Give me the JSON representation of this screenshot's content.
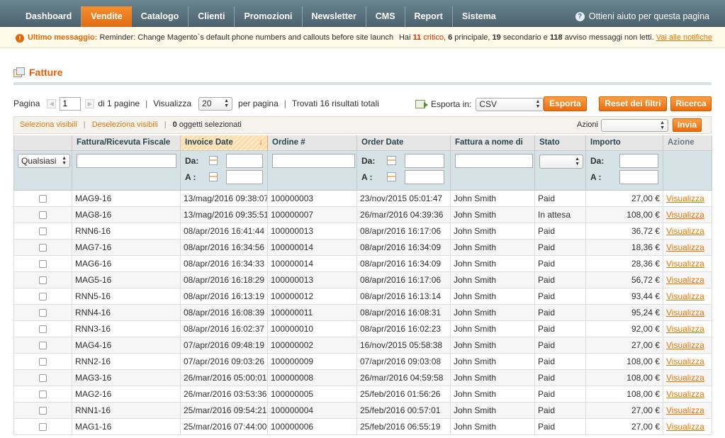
{
  "nav": {
    "items": [
      "Dashboard",
      "Vendite",
      "Catalogo",
      "Clienti",
      "Promozioni",
      "Newsletter",
      "CMS",
      "Report",
      "Sistema"
    ],
    "active_index": 1,
    "help_label": "Ottieni aiuto per questa pagina"
  },
  "notice": {
    "label": "Ultimo messaggio:",
    "text": "Reminder: Change Magento`s default phone numbers and callouts before site launch",
    "pre": "Hai",
    "critical_count": "11",
    "critical_label": "critico,",
    "major_count": "6",
    "major_label": "principale,",
    "minor_count": "19",
    "minor_label": "secondario e",
    "notice_count": "118",
    "notice_label": "avviso messaggi non letti.",
    "link": "Vai alle notifiche"
  },
  "page": {
    "title": "Fatture"
  },
  "pager": {
    "page_label": "Pagina",
    "page_value": "1",
    "of_pages": "di 1 pagine",
    "show_label": "Visualizza",
    "per_page_value": "20",
    "per_page_label": "per pagina",
    "found": "Trovati 16 risultati totali"
  },
  "export": {
    "label": "Esporta in:",
    "format": "CSV",
    "export_button": "Esporta",
    "reset_button": "Reset dei filtri",
    "search_button": "Ricerca"
  },
  "massaction": {
    "select_visible": "Seleziona visibili",
    "deselect_visible": "Deseleziona visibili",
    "selected_count": "0",
    "selected_label": "oggetti selezionati",
    "actions_label": "Azioni",
    "submit_button": "Invia"
  },
  "grid": {
    "headers": [
      "",
      "Fattura/Ricevuta Fiscale",
      "Invoice Date",
      "Ordine #",
      "Order Date",
      "Fattura a nome di",
      "Stato",
      "Importo",
      "Azione"
    ],
    "sorted_arrow": "↓",
    "filter": {
      "any_option": "Qualsiasi",
      "from_label": "Da:",
      "to_label": "A :"
    },
    "rows": [
      {
        "invoice": "MAG9-16",
        "invoice_date": "13/mag/2016 09:38:07",
        "order": "100000003",
        "order_date": "23/nov/2015 05:01:47",
        "bill_to": "John Smith",
        "status": "Paid",
        "amount": "27,00 €",
        "action": "Visualizza"
      },
      {
        "invoice": "MAG8-16",
        "invoice_date": "13/mag/2016 09:35:51",
        "order": "100000007",
        "order_date": "26/mar/2016 04:39:36",
        "bill_to": "John Smith",
        "status": "In attesa",
        "amount": "108,00 €",
        "action": "Visualizza"
      },
      {
        "invoice": "RNN6-16",
        "invoice_date": "08/apr/2016 16:41:44",
        "order": "100000013",
        "order_date": "08/apr/2016 16:17:06",
        "bill_to": "John Smith",
        "status": "Paid",
        "amount": "36,72 €",
        "action": "Visualizza"
      },
      {
        "invoice": "MAG7-16",
        "invoice_date": "08/apr/2016 16:34:56",
        "order": "100000014",
        "order_date": "08/apr/2016 16:34:09",
        "bill_to": "John Smith",
        "status": "Paid",
        "amount": "18,36 €",
        "action": "Visualizza"
      },
      {
        "invoice": "MAG6-16",
        "invoice_date": "08/apr/2016 16:34:33",
        "order": "100000014",
        "order_date": "08/apr/2016 16:34:09",
        "bill_to": "John Smith",
        "status": "Paid",
        "amount": "28,36 €",
        "action": "Visualizza"
      },
      {
        "invoice": "MAG5-16",
        "invoice_date": "08/apr/2016 16:18:29",
        "order": "100000013",
        "order_date": "08/apr/2016 16:17:06",
        "bill_to": "John Smith",
        "status": "Paid",
        "amount": "56,72 €",
        "action": "Visualizza"
      },
      {
        "invoice": "RNN5-16",
        "invoice_date": "08/apr/2016 16:13:19",
        "order": "100000012",
        "order_date": "08/apr/2016 16:13:14",
        "bill_to": "John Smith",
        "status": "Paid",
        "amount": "93,44 €",
        "action": "Visualizza"
      },
      {
        "invoice": "RNN4-16",
        "invoice_date": "08/apr/2016 16:08:39",
        "order": "100000011",
        "order_date": "08/apr/2016 16:08:31",
        "bill_to": "John Smith",
        "status": "Paid",
        "amount": "95,24 €",
        "action": "Visualizza"
      },
      {
        "invoice": "RNN3-16",
        "invoice_date": "08/apr/2016 16:02:37",
        "order": "100000010",
        "order_date": "08/apr/2016 16:02:23",
        "bill_to": "John Smith",
        "status": "Paid",
        "amount": "92,00 €",
        "action": "Visualizza"
      },
      {
        "invoice": "MAG4-16",
        "invoice_date": "07/apr/2016 09:48:19",
        "order": "100000002",
        "order_date": "16/nov/2015 05:58:38",
        "bill_to": "John Smith",
        "status": "Paid",
        "amount": "27,00 €",
        "action": "Visualizza"
      },
      {
        "invoice": "RNN2-16",
        "invoice_date": "07/apr/2016 09:03:26",
        "order": "100000009",
        "order_date": "07/apr/2016 09:03:08",
        "bill_to": "John Smith",
        "status": "Paid",
        "amount": "108,00 €",
        "action": "Visualizza"
      },
      {
        "invoice": "MAG3-16",
        "invoice_date": "26/mar/2016 05:00:01",
        "order": "100000008",
        "order_date": "26/mar/2016 04:59:58",
        "bill_to": "John Smith",
        "status": "Paid",
        "amount": "108,00 €",
        "action": "Visualizza"
      },
      {
        "invoice": "MAG2-16",
        "invoice_date": "26/mar/2016 03:53:36",
        "order": "100000005",
        "order_date": "25/feb/2016 01:56:26",
        "bill_to": "John Smith",
        "status": "Paid",
        "amount": "108,00 €",
        "action": "Visualizza"
      },
      {
        "invoice": "RNN1-16",
        "invoice_date": "25/mar/2016 09:54:21",
        "order": "100000004",
        "order_date": "25/feb/2016 00:57:01",
        "bill_to": "John Smith",
        "status": "Paid",
        "amount": "27,00 €",
        "action": "Visualizza"
      },
      {
        "invoice": "MAG1-16",
        "invoice_date": "25/mar/2016 07:44:00",
        "order": "100000006",
        "order_date": "25/feb/2016 06:55:19",
        "bill_to": "John Smith",
        "status": "Paid",
        "amount": "27,00 €",
        "action": "Visualizza"
      }
    ]
  },
  "icons": {
    "help": "help-icon",
    "warning": "warning-icon",
    "title": "invoice-icon",
    "export": "export-icon",
    "calendar": "calendar-icon"
  },
  "colors": {
    "accent": "#eb6b0c",
    "nav": "#5a7380",
    "link": "#ea7601"
  }
}
